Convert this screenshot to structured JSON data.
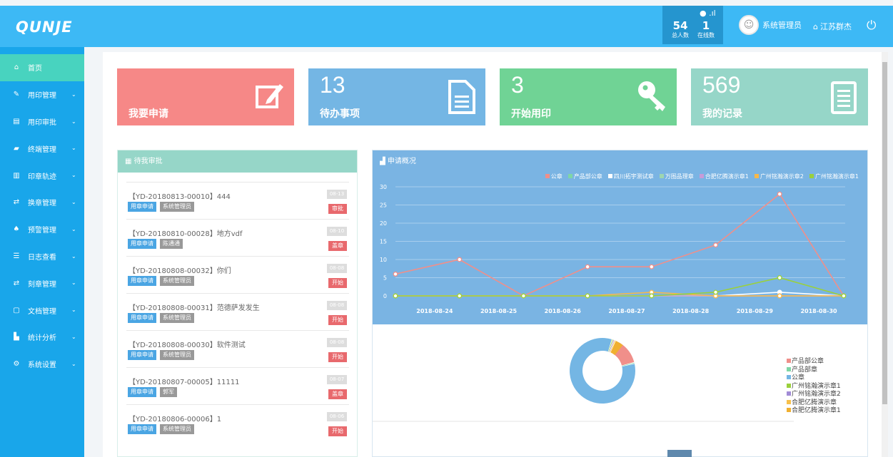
{
  "app": {
    "logo": "QUNJE"
  },
  "header": {
    "total_count": "54",
    "total_label": "总人数",
    "online_count": "1",
    "online_label": "在线数",
    "user_name": "系统管理员",
    "company": "江苏群杰"
  },
  "sidebar": {
    "items": [
      {
        "label": "首页",
        "icon": "home-icon"
      },
      {
        "label": "用印管理",
        "icon": "edit-icon"
      },
      {
        "label": "用印审批",
        "icon": "file-icon"
      },
      {
        "label": "终端管理",
        "icon": "folder-icon"
      },
      {
        "label": "印章轨迹",
        "icon": "map-icon"
      },
      {
        "label": "换章管理",
        "icon": "exchange-icon"
      },
      {
        "label": "预警管理",
        "icon": "bell-icon"
      },
      {
        "label": "日志查看",
        "icon": "list-icon"
      },
      {
        "label": "刻章管理",
        "icon": "exchange-icon"
      },
      {
        "label": "文档管理",
        "icon": "document-icon"
      },
      {
        "label": "统计分析",
        "icon": "bar-chart-icon"
      },
      {
        "label": "系统设置",
        "icon": "gear-icon"
      }
    ]
  },
  "cards": [
    {
      "number": "",
      "label": "我要申请",
      "color": "#f68887",
      "icon": "edit-icon"
    },
    {
      "number": "13",
      "label": "待办事项",
      "color": "#74b6e4",
      "icon": "file-icon"
    },
    {
      "number": "3",
      "label": "开始用印",
      "color": "#70d395",
      "icon": "key-icon"
    },
    {
      "number": "569",
      "label": "我的记录",
      "color": "#96d6c8",
      "icon": "list-icon"
    }
  ],
  "todo": {
    "title": "待我审批",
    "items": [
      {
        "title": "【YD-20180813-00010】444",
        "type": "用章申请",
        "user": "系统管理员",
        "date": "08-13",
        "action": "审批"
      },
      {
        "title": "【YD-20180810-00028】地方vdf",
        "type": "用章申请",
        "user": "陈通通",
        "date": "08-10",
        "action": "盖章"
      },
      {
        "title": "【YD-20180808-00032】你们",
        "type": "用章申请",
        "user": "系统管理员",
        "date": "08-08",
        "action": "开始"
      },
      {
        "title": "【YD-20180808-00031】范德萨发发生",
        "type": "用章申请",
        "user": "系统管理员",
        "date": "08-08",
        "action": "开始"
      },
      {
        "title": "【YD-20180808-00030】软件测试",
        "type": "用章申请",
        "user": "系统管理员",
        "date": "08-08",
        "action": "开始"
      },
      {
        "title": "【YD-20180807-00005】11111",
        "type": "用章申请",
        "user": "郭军",
        "date": "08-07",
        "action": "盖章"
      },
      {
        "title": "【YD-20180806-00006】1",
        "type": "用章申请",
        "user": "系统管理员",
        "date": "08-06",
        "action": "开始"
      }
    ]
  },
  "overview": {
    "title": "申请概况",
    "legend": [
      {
        "name": "公章",
        "color": "#f08f8a"
      },
      {
        "name": "产品部公章",
        "color": "#7fd6a6"
      },
      {
        "name": "四川拓宇测试章",
        "color": "#ffffff"
      },
      {
        "name": "万图品理章",
        "color": "#9ed6b0"
      },
      {
        "name": "合肥亿腾演示章1",
        "color": "#c79bd8"
      },
      {
        "name": "广州铭瀚演示章2",
        "color": "#f7b84b"
      },
      {
        "name": "广州铭瀚演示章1",
        "color": "#9ad03c"
      }
    ]
  },
  "chart_data": [
    {
      "type": "line",
      "x": [
        "2018-08-24",
        "2018-08-25",
        "2018-08-26",
        "2018-08-27",
        "2018-08-28",
        "2018-08-29",
        "2018-08-30"
      ],
      "ylim": [
        0,
        30
      ],
      "yticks": [
        0,
        5,
        10,
        15,
        20,
        25,
        30
      ],
      "grid": true,
      "legend_position": "top-right",
      "series": [
        {
          "name": "公章",
          "color": "#f08f8a",
          "values": [
            6,
            10,
            0,
            8,
            8,
            14,
            28,
            0
          ]
        },
        {
          "name": "产品部公章",
          "color": "#7fd6a6",
          "values": [
            0,
            0,
            0,
            0,
            0,
            0,
            0,
            0
          ]
        },
        {
          "name": "四川拓宇测试章",
          "color": "#ffffff",
          "values": [
            0,
            0,
            0,
            0,
            0,
            0,
            1,
            0
          ]
        },
        {
          "name": "万图品理章",
          "color": "#9ed6b0",
          "values": [
            0,
            0,
            0,
            0,
            0,
            0,
            0,
            0
          ]
        },
        {
          "name": "合肥亿腾演示章1",
          "color": "#c79bd8",
          "values": [
            0,
            0,
            0,
            0,
            0,
            0,
            0,
            0
          ]
        },
        {
          "name": "广州铭瀚演示章2",
          "color": "#f7b84b",
          "values": [
            0,
            0,
            0,
            0,
            1,
            0,
            0,
            0
          ]
        },
        {
          "name": "广州铭瀚演示章1",
          "color": "#9ad03c",
          "values": [
            0,
            0,
            0,
            0,
            0,
            1,
            5,
            0
          ]
        }
      ]
    },
    {
      "type": "pie",
      "legend_position": "right",
      "categories": [
        "产品部公章",
        "产品部章",
        "公章",
        "广州铭瀚演示章1",
        "广州铭瀚演示章2",
        "合肥亿腾演示章",
        "合肥亿腾演示章1"
      ],
      "colors": [
        "#f08f8a",
        "#7fd6a6",
        "#74b6e4",
        "#9ad03c",
        "#a28cd6",
        "#f7c04b",
        "#f0b030"
      ],
      "values": [
        12,
        0.3,
        83,
        0.3,
        0.3,
        0.3,
        4
      ]
    }
  ]
}
